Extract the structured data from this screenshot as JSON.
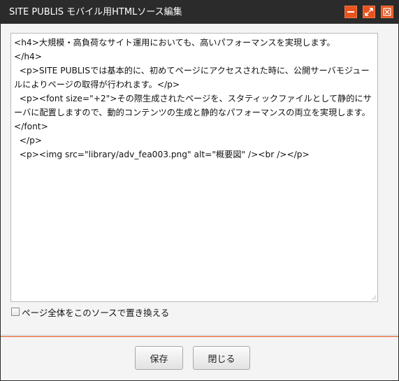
{
  "window": {
    "title": "SITE PUBLIS モバイル用HTMLソース編集",
    "accent_color": "#e8531d",
    "titlebar_color": "#2b2b2b",
    "buttons": [
      {
        "icon": "minimize-icon"
      },
      {
        "icon": "maximize-icon"
      },
      {
        "icon": "close-icon"
      }
    ]
  },
  "editor": {
    "source": "<h4>大規模・高負荷なサイト運用においても、高いパフォーマンスを実現します。\n</h4>\n  <p>SITE PUBLISでは基本的に、初めてページにアクセスされた時に、公開サーバモジュールによりページの取得が行われます。</p>\n  <p><font size=\"+2\">その際生成されたページを、スタティックファイルとして静的にサーバに配置しますので、動的コンテンツの生成と静的なパフォーマンスの両立を実現します。</font>\n  </p>\n  <p><img src=\"library/adv_fea003.png\" alt=\"概要図\" /><br /></p>"
  },
  "options": {
    "replace_all_label": "ページ全体をこのソースで置き換える",
    "replace_all_checked": false
  },
  "footer": {
    "save_label": "保存",
    "close_label": "閉じる"
  }
}
